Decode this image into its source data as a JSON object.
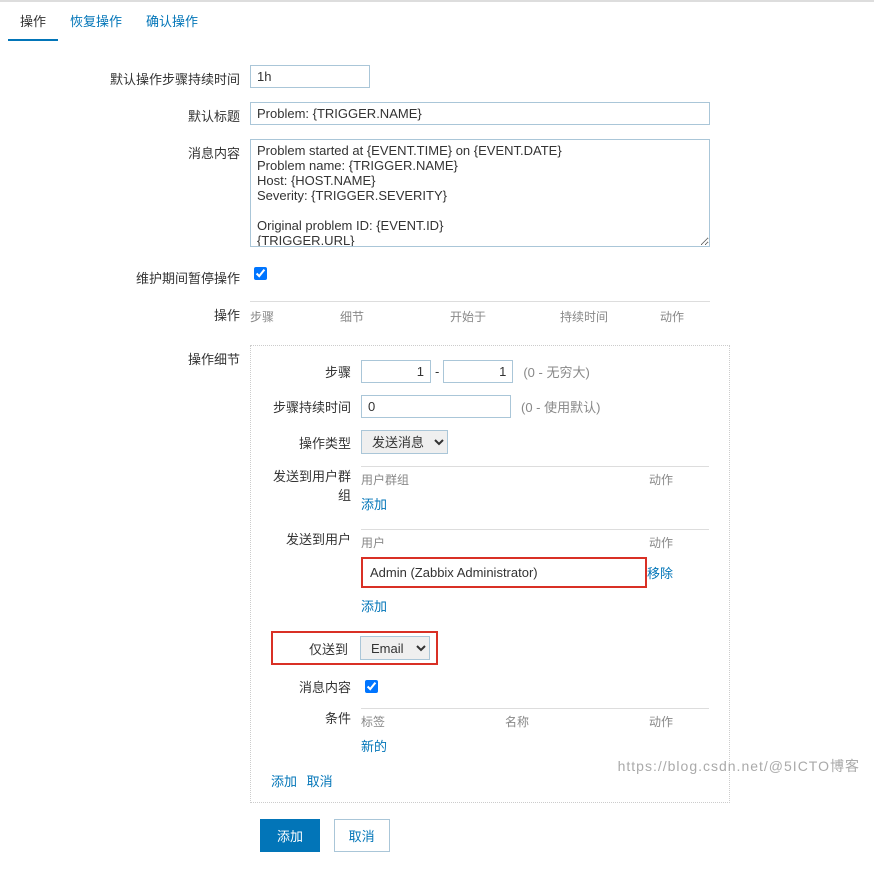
{
  "tabs": {
    "operation": "操作",
    "recovery": "恢复操作",
    "ack": "确认操作"
  },
  "labels": {
    "default_duration": "默认操作步骤持续时间",
    "default_subject": "默认标题",
    "message_content": "消息内容",
    "pause_maintenance": "维护期间暂停操作",
    "operations": "操作",
    "operation_detail": "操作细节"
  },
  "fields": {
    "default_duration": "1h",
    "default_subject": "Problem: {TRIGGER.NAME}",
    "message_content": "Problem started at {EVENT.TIME} on {EVENT.DATE}\nProblem name: {TRIGGER.NAME}\nHost: {HOST.NAME}\nSeverity: {TRIGGER.SEVERITY}\n\nOriginal problem ID: {EVENT.ID}\n{TRIGGER.URL}"
  },
  "ops_header": {
    "step": "步骤",
    "detail": "细节",
    "start": "开始于",
    "duration": "持续时间",
    "action": "动作"
  },
  "detail": {
    "labels": {
      "step": "步骤",
      "step_duration": "步骤持续时间",
      "op_type": "操作类型",
      "send_group": "发送到用户群组",
      "send_user": "发送到用户",
      "only_to": "仅送到",
      "msg_content": "消息内容",
      "condition": "条件"
    },
    "step_from": "1",
    "step_to": "1",
    "step_hint": "(0 - 无穷大)",
    "step_duration": "0",
    "step_duration_hint": "(0 - 使用默认)",
    "op_type": "发送消息",
    "group_header": {
      "c1": "用户群组",
      "c2": "动作"
    },
    "group_add": "添加",
    "user_header": {
      "c1": "用户",
      "c2": "动作"
    },
    "user_row": {
      "name": "Admin (Zabbix Administrator)",
      "action": "移除"
    },
    "user_add": "添加",
    "only_to": "Email",
    "cond_header": {
      "c1": "标签",
      "c2": "名称",
      "c3": "动作"
    },
    "cond_new": "新的",
    "footer": {
      "add": "添加",
      "cancel": "取消"
    }
  },
  "buttons": {
    "add": "添加",
    "cancel": "取消"
  },
  "watermark": "https://blog.csdn.net/@5ICTO博客"
}
